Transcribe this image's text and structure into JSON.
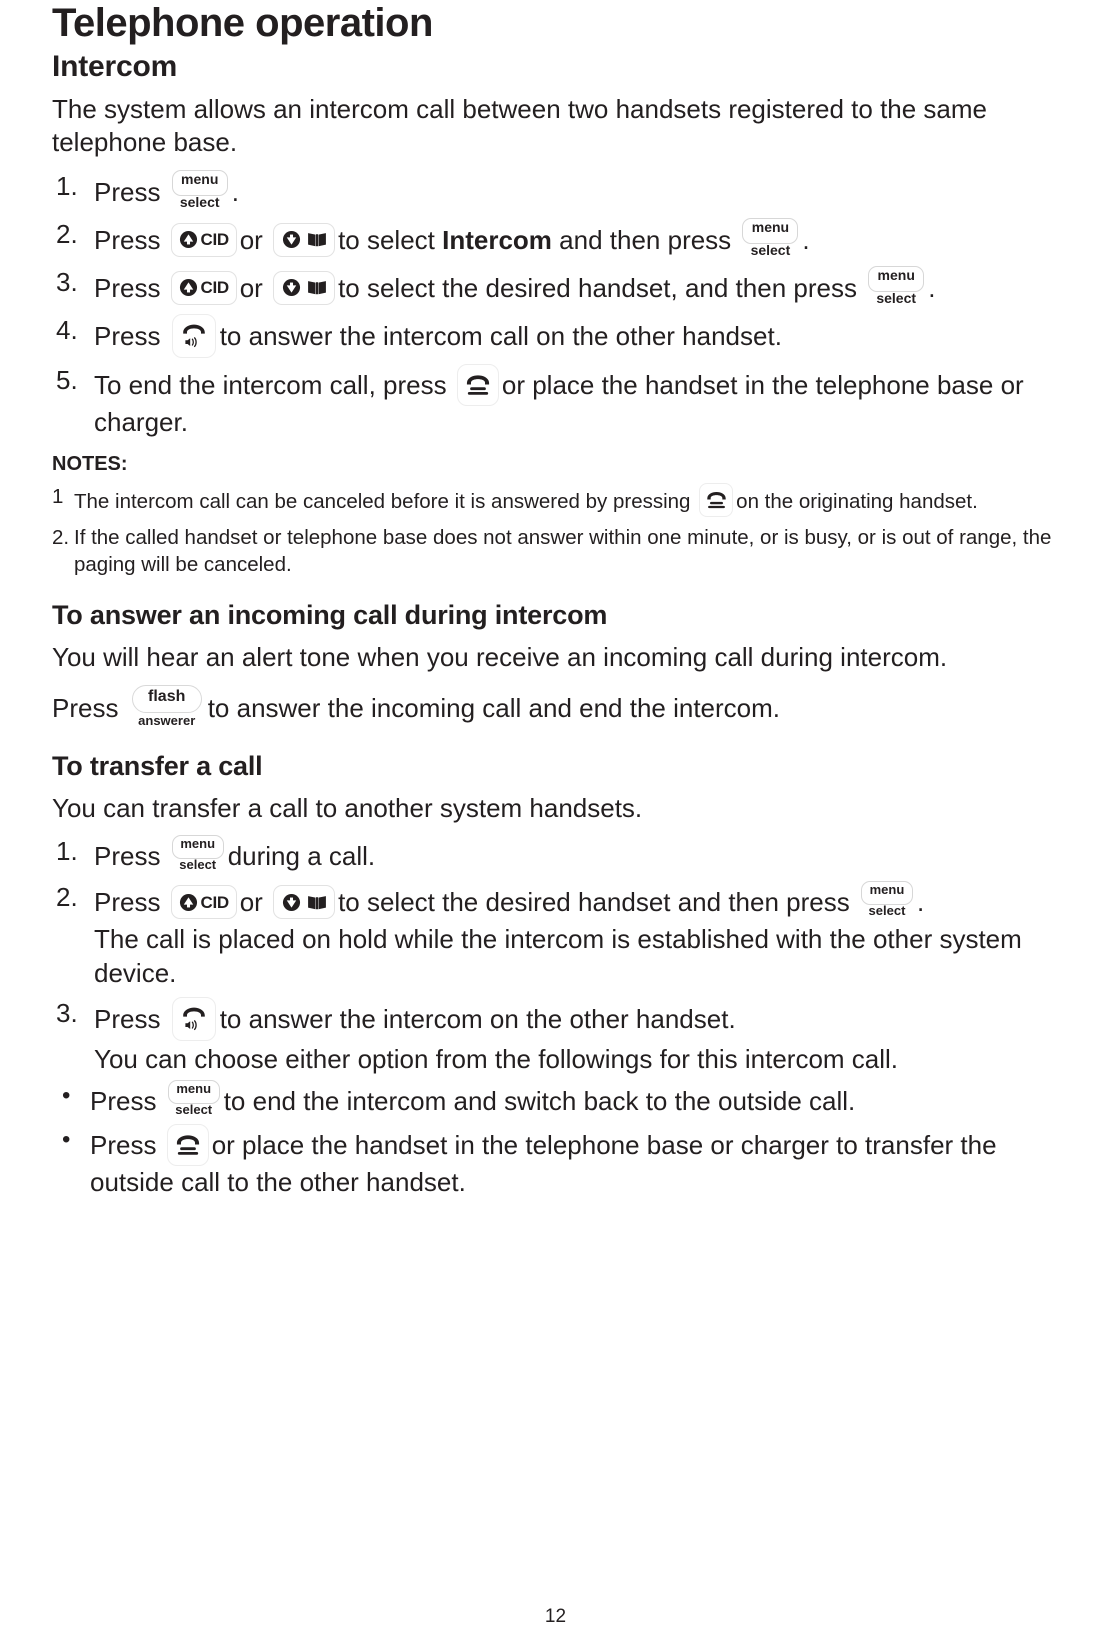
{
  "document": {
    "title": "Telephone operation",
    "page_number": "12"
  },
  "intercom": {
    "heading": "Intercom",
    "intro": "The system allows an intercom call between two handsets registered to the same telephone base.",
    "steps": [
      {
        "num": "1.",
        "before": "Press",
        "key1": "menu-select",
        "after": "."
      },
      {
        "num": "2.",
        "before": "Press",
        "key1": "cid-up",
        "mid1": "or",
        "key2": "down-directory",
        "mid2": "to select",
        "bold": "Intercom",
        "mid3": "and then press",
        "key3": "menu-select",
        "after": "."
      },
      {
        "num": "3.",
        "before": "Press",
        "key1": "cid-up",
        "mid1": "or",
        "key2": "down-directory",
        "mid2": "to select the desired handset, and then press",
        "key3": "menu-select",
        "after": "."
      },
      {
        "num": "4.",
        "before": "Press",
        "key1": "speakerphone",
        "after": "to answer the intercom call on the other handset."
      },
      {
        "num": "5.",
        "before": "To end the intercom call, press",
        "key1": "end-call",
        "after": "or place the handset in the telephone base or charger."
      }
    ]
  },
  "notes": {
    "label": "NOTES:",
    "items": [
      {
        "num": "1",
        "before": "The intercom call can be canceled before it is answered by pressing",
        "key1": "end-call",
        "after": "on the originating handset."
      },
      {
        "num": "2.",
        "before": "If the called handset or telephone base does not answer within one minute, or is busy, or is out of range, the paging will be canceled.",
        "after": ""
      }
    ]
  },
  "answer_during_intercom": {
    "heading": "To answer an incoming call during intercom",
    "paragraph": "You will hear an alert tone when you receive an incoming call during intercom.",
    "press_line": {
      "before": "Press",
      "key1": "flash-answerer",
      "after": "to answer the incoming call and end the intercom."
    }
  },
  "transfer_call": {
    "heading": "To transfer a call",
    "intro": "You can transfer a call to another system handsets.",
    "steps": [
      {
        "num": "1.",
        "before": "Press",
        "key1": "menu-select",
        "after": "during a call."
      },
      {
        "num": "2.",
        "before": "Press",
        "key1": "cid-up",
        "mid1": "or",
        "key2": "down-directory",
        "mid2": "to select the desired handset and then press",
        "key3": "menu-select",
        "after": ".",
        "sub": "The call is placed on hold while the intercom is established with the other system device."
      },
      {
        "num": "3.",
        "before": "Press",
        "key1": "speakerphone",
        "after": "to answer the intercom on the other handset.",
        "sub": "You can choose either option from the followings for this intercom call."
      }
    ],
    "bullets": [
      {
        "marker": "•",
        "before": "Press",
        "key1": "menu-select",
        "after": "to end the intercom and switch back to the outside call."
      },
      {
        "marker": "•",
        "before": "Press",
        "key1": "end-call",
        "after": "or place the handset in the telephone base or charger to transfer the outside call to the other handset."
      }
    ]
  },
  "keys": {
    "menu_select": {
      "top": "menu",
      "bottom": "select"
    },
    "cid": {
      "label": "CID",
      "icon": "up-triangle-icon"
    },
    "directory": {
      "icon_down": "down-triangle-icon",
      "icon_book": "open-book-icon"
    },
    "speakerphone": {
      "icon": "speakerphone-icon"
    },
    "end_call": {
      "icon": "handset-icon"
    },
    "flash": {
      "top": "flash",
      "bottom": "answerer"
    }
  }
}
